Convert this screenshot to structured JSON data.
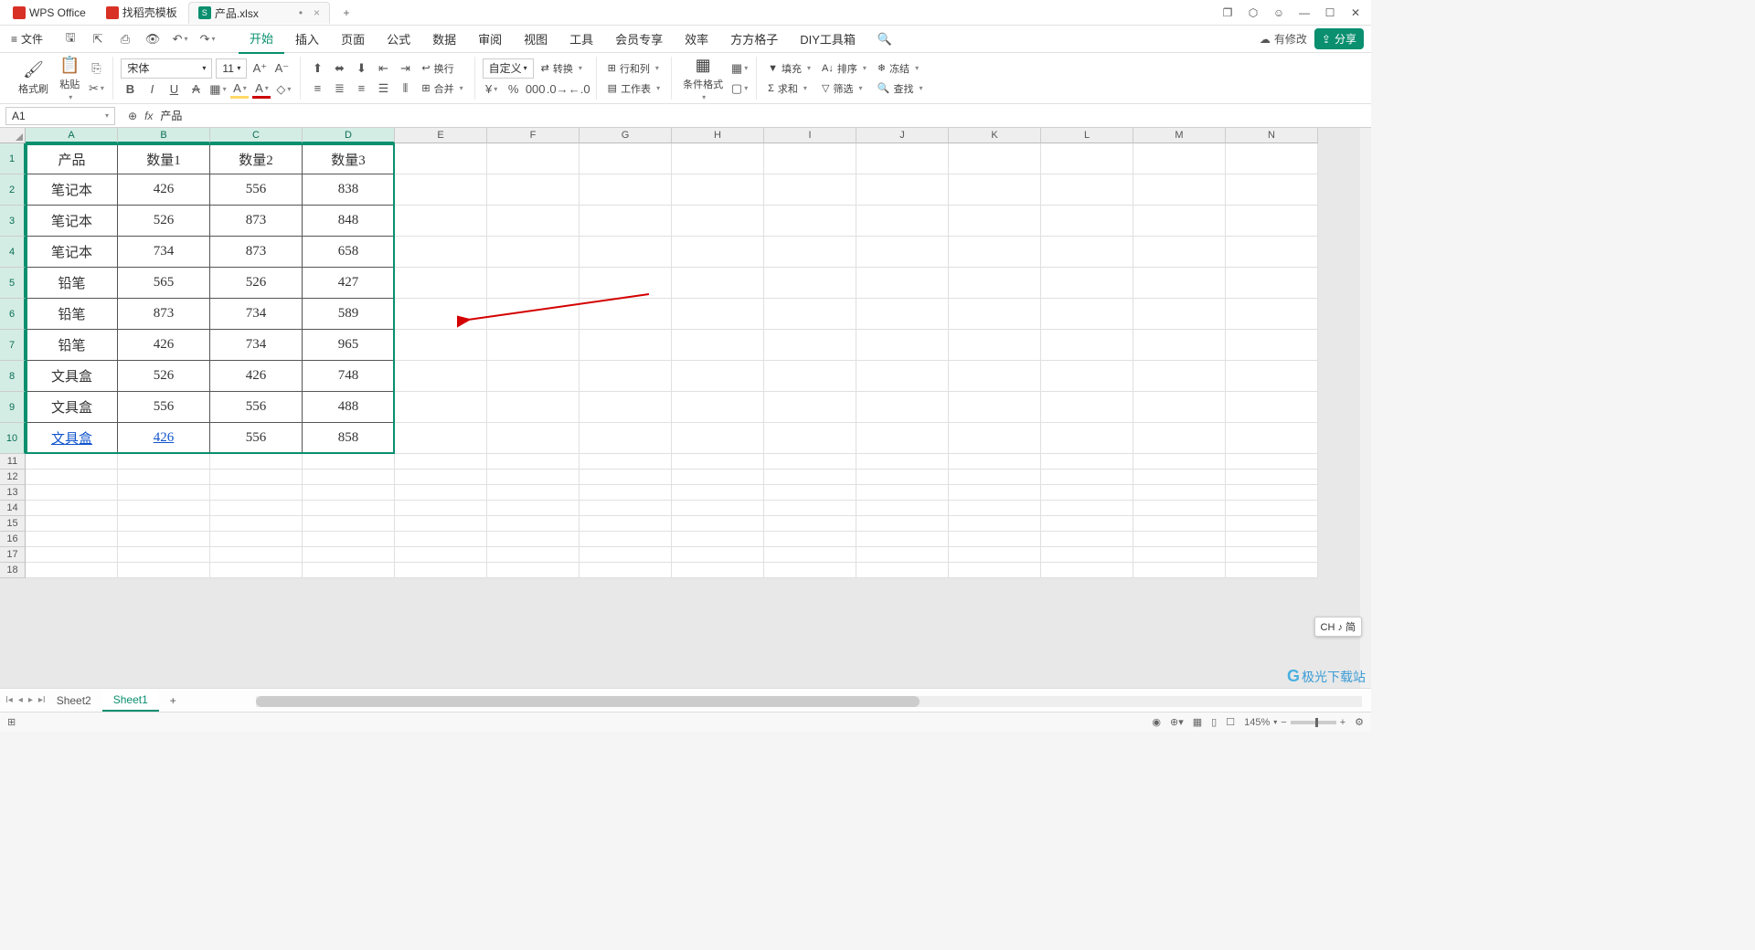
{
  "tabs": [
    {
      "label": "WPS Office",
      "icon_color": "#d93025"
    },
    {
      "label": "找稻壳模板",
      "icon_color": "#d93025"
    },
    {
      "label": "产品.xlsx",
      "icon_color": "#0a8f6f",
      "active": true,
      "modified": "•"
    }
  ],
  "newtab": "+",
  "window_controls": {
    "copy": "❐",
    "cube": "⬡",
    "user": "☺",
    "min": "—",
    "max": "☐",
    "close": "✕"
  },
  "file_menu": "文件",
  "qat_icons": [
    "save",
    "export",
    "print",
    "preview",
    "undo",
    "redo"
  ],
  "menu_tabs": [
    "开始",
    "插入",
    "页面",
    "公式",
    "数据",
    "审阅",
    "视图",
    "工具",
    "会员专享",
    "效率",
    "方方格子",
    "DIY工具箱"
  ],
  "menu_active": "开始",
  "search_icon": "search",
  "modify_label": "有修改",
  "share_label": "分享",
  "ribbon": {
    "paste": "格式刷",
    "paste2": "粘贴",
    "font_name": "宋体",
    "font_size": "11",
    "custom": "自定义",
    "transform": "转换",
    "rowscols": "行和列",
    "worksheet": "工作表",
    "condfmt": "条件格式",
    "fill": "填充",
    "sort": "排序",
    "freeze": "冻结",
    "sum": "求和",
    "filter": "筛选",
    "find": "查找",
    "wrap": "换行",
    "merge": "合并"
  },
  "name_box": "A1",
  "formula_value": "产品",
  "columns": [
    "A",
    "B",
    "C",
    "D",
    "E",
    "F",
    "G",
    "H",
    "I",
    "J",
    "K",
    "L",
    "M",
    "N"
  ],
  "data_cols_selected": 4,
  "headers": [
    "产品",
    "数量1",
    "数量2",
    "数量3"
  ],
  "rows": [
    [
      "笔记本",
      "426",
      "556",
      "838"
    ],
    [
      "笔记本",
      "526",
      "873",
      "848"
    ],
    [
      "笔记本",
      "734",
      "873",
      "658"
    ],
    [
      "铅笔",
      "565",
      "526",
      "427"
    ],
    [
      "铅笔",
      "873",
      "734",
      "589"
    ],
    [
      "铅笔",
      "426",
      "734",
      "965"
    ],
    [
      "文具盒",
      "526",
      "426",
      "748"
    ],
    [
      "文具盒",
      "556",
      "556",
      "488"
    ],
    [
      "文具盒",
      "426",
      "556",
      "858"
    ]
  ],
  "link_row_index": 8,
  "link_cells": [
    0,
    1
  ],
  "total_rows_shown": 18,
  "sheets": [
    "Sheet2",
    "Sheet1"
  ],
  "active_sheet": "Sheet1",
  "zoom": "145%",
  "ime": "CH ♪ 简",
  "watermark": "极光下载站",
  "watermark_url": "www.xz7.com"
}
